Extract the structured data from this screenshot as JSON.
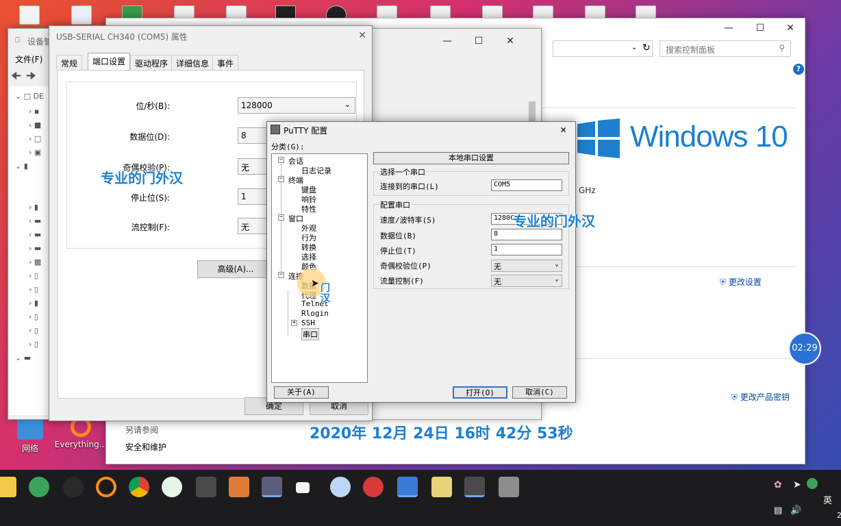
{
  "desktop": {
    "icons": [
      {
        "label": "网络"
      },
      {
        "label": "Everything..."
      }
    ]
  },
  "system_window": {
    "search_placeholder": "搜索控制面板",
    "help": "?",
    "windows_logo_text": "Windows 10",
    "cpu_suffix": "GHz",
    "change_settings": "更改设置",
    "change_product_key": "更改产品密钥",
    "see_also": "另请参阅",
    "security": "安全和维护"
  },
  "device_manager": {
    "title": "设备管",
    "menu_file": "文件(F)",
    "root_label": "DE"
  },
  "properties": {
    "title": "USB-SERIAL CH340 (COM5) 属性",
    "tabs": [
      "常规",
      "端口设置",
      "驱动程序",
      "详细信息",
      "事件"
    ],
    "fields": [
      {
        "label": "位/秒(B):",
        "value": "128000"
      },
      {
        "label": "数据位(D):",
        "value": "8"
      },
      {
        "label": "奇偶校验(P):",
        "value": "无"
      },
      {
        "label": "停止位(S):",
        "value": "1"
      },
      {
        "label": "流控制(F):",
        "value": "无"
      }
    ],
    "advanced": "高级(A)...",
    "ok": "确定",
    "cancel": "取消"
  },
  "putty": {
    "title": "PuTTY 配置",
    "category_label": "分类(G):",
    "tree": [
      {
        "label": "会话",
        "level": 0,
        "expander": "⊟"
      },
      {
        "label": "日志记录",
        "level": 1
      },
      {
        "label": "终端",
        "level": 0,
        "expander": "⊟"
      },
      {
        "label": "键盘",
        "level": 1
      },
      {
        "label": "响铃",
        "level": 1
      },
      {
        "label": "特性",
        "level": 1
      },
      {
        "label": "窗口",
        "level": 0,
        "expander": "⊟"
      },
      {
        "label": "外观",
        "level": 1
      },
      {
        "label": "行为",
        "level": 1
      },
      {
        "label": "转换",
        "level": 1
      },
      {
        "label": "选择",
        "level": 1
      },
      {
        "label": "颜色",
        "level": 1
      },
      {
        "label": "连接",
        "level": 0,
        "expander": "⊟"
      },
      {
        "label": "数据",
        "level": 1
      },
      {
        "label": "代理",
        "level": 1
      },
      {
        "label": "Telnet",
        "level": 1
      },
      {
        "label": "Rlogin",
        "level": 1
      },
      {
        "label": "SSH",
        "level": 1,
        "expander": "⊞"
      },
      {
        "label": "串口",
        "level": 1,
        "selected": true
      }
    ],
    "panel_header": "本地串口设置",
    "group1_title": "选择一个串口",
    "connect_label": "连接到的串口(L)",
    "connect_value": "COM5",
    "group2_title": "配置串口",
    "config": [
      {
        "label": "速度/波特率(S)",
        "value": "1280C",
        "type": "field"
      },
      {
        "label": "数据位(B)",
        "value": "8",
        "type": "field"
      },
      {
        "label": "停止位(T)",
        "value": "1",
        "type": "field"
      },
      {
        "label": "奇偶校验位(P)",
        "value": "无",
        "type": "select"
      },
      {
        "label": "流量控制(F)",
        "value": "无",
        "type": "select"
      }
    ],
    "about": "关于(A)",
    "open": "打开(O)",
    "cancel": "取消(C)"
  },
  "overlay": {
    "watermark": "专业的门外汉",
    "partial_1": "门",
    "partial_2": "汉",
    "datetime": "2020年 12月 24日 16时 42分 53秒",
    "timer": "02:29"
  },
  "taskbar": {
    "ime": "英",
    "clock_fragment": "2"
  }
}
